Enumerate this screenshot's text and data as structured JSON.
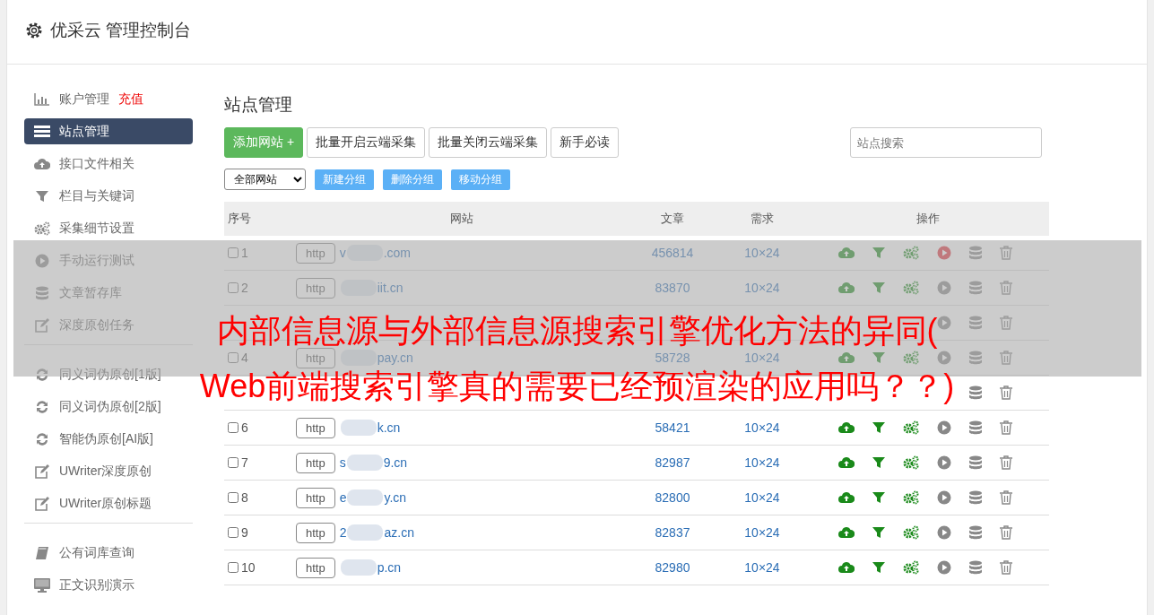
{
  "header": {
    "title": "优采云 管理控制台"
  },
  "sidebar": {
    "groups": [
      {
        "items": [
          {
            "label": "账户管理",
            "badge": "充值",
            "kind": "chart",
            "selected": false
          },
          {
            "label": "站点管理",
            "kind": "list",
            "selected": true
          },
          {
            "label": "接口文件相关",
            "kind": "cloud",
            "selected": false
          },
          {
            "label": "栏目与关键词",
            "kind": "filter",
            "selected": false
          },
          {
            "label": "采集细节设置",
            "kind": "gears",
            "selected": false
          },
          {
            "label": "手动运行测试",
            "kind": "play",
            "selected": false
          },
          {
            "label": "文章暂存库",
            "kind": "database",
            "selected": false
          },
          {
            "label": "深度原创任务",
            "kind": "edit",
            "selected": false
          }
        ]
      },
      {
        "items": [
          {
            "label": "同义词伪原创[1版]",
            "kind": "refresh",
            "selected": false
          },
          {
            "label": "同义词伪原创[2版]",
            "kind": "refresh",
            "selected": false
          },
          {
            "label": "智能伪原创[AI版]",
            "kind": "refresh",
            "selected": false
          },
          {
            "label": "UWriter深度原创",
            "kind": "edit",
            "selected": false
          },
          {
            "label": "UWriter原创标题",
            "kind": "edit",
            "selected": false
          }
        ]
      },
      {
        "items": [
          {
            "label": "公有词库查询",
            "kind": "book",
            "selected": false
          },
          {
            "label": "正文识别演示",
            "kind": "monitor",
            "selected": false
          }
        ]
      }
    ]
  },
  "main": {
    "title": "站点管理",
    "buttons": [
      {
        "label": "添加网站 +",
        "kind": "primary"
      },
      {
        "label": "批量开启云端采集",
        "kind": "default"
      },
      {
        "label": "批量关闭云端采集",
        "kind": "default"
      },
      {
        "label": "新手必读",
        "kind": "default"
      }
    ],
    "search": {
      "placeholder": "站点搜索"
    },
    "group_select": {
      "value": "全部网站"
    },
    "group_buttons": [
      "新建分组",
      "删除分组",
      "移动分组"
    ],
    "table": {
      "columns": [
        "序号",
        "网站",
        "文章",
        "需求",
        "操作"
      ],
      "rows": [
        {
          "no": "1",
          "checked": false,
          "protocol": "http",
          "site_start": "v",
          "site_end": ".com",
          "articles": "456814",
          "demand": "10×24",
          "running": true
        },
        {
          "no": "2",
          "checked": false,
          "protocol": "http",
          "site_end": "iit.cn",
          "articles": "83870",
          "demand": "10×24",
          "running": false
        },
        {
          "running": false
        },
        {
          "no": "4",
          "checked": false,
          "protocol": "http",
          "site_end": "pay.cn",
          "articles": "58728",
          "demand": "10×24",
          "running": false
        },
        {},
        {
          "no": "6",
          "checked": false,
          "protocol": "http",
          "site_end": "k.cn",
          "articles": "58421",
          "demand": "10×24",
          "running": false
        },
        {
          "no": "7",
          "checked": false,
          "protocol": "http",
          "site_start": "s",
          "site_end": "9.cn",
          "articles": "82987",
          "demand": "10×24",
          "running": false
        },
        {
          "no": "8",
          "checked": false,
          "protocol": "http",
          "site_start": "e",
          "site_end": "y.cn",
          "articles": "82800",
          "demand": "10×24",
          "running": false
        },
        {
          "no": "9",
          "checked": false,
          "protocol": "http",
          "site_start": "2",
          "site_end": "az.cn",
          "articles": "82837",
          "demand": "10×24",
          "running": false
        },
        {
          "no": "10",
          "checked": false,
          "protocol": "http",
          "site_end": "p.cn",
          "articles": "82980",
          "demand": "10×24",
          "running": false
        }
      ]
    }
  },
  "overlay_banner": {
    "lines": [
      "内部信息源与外部信息源搜索引擎优化方法的异同(",
      "Web前端搜索引擎真的需要已经预渲染的应用吗？？)"
    ]
  }
}
